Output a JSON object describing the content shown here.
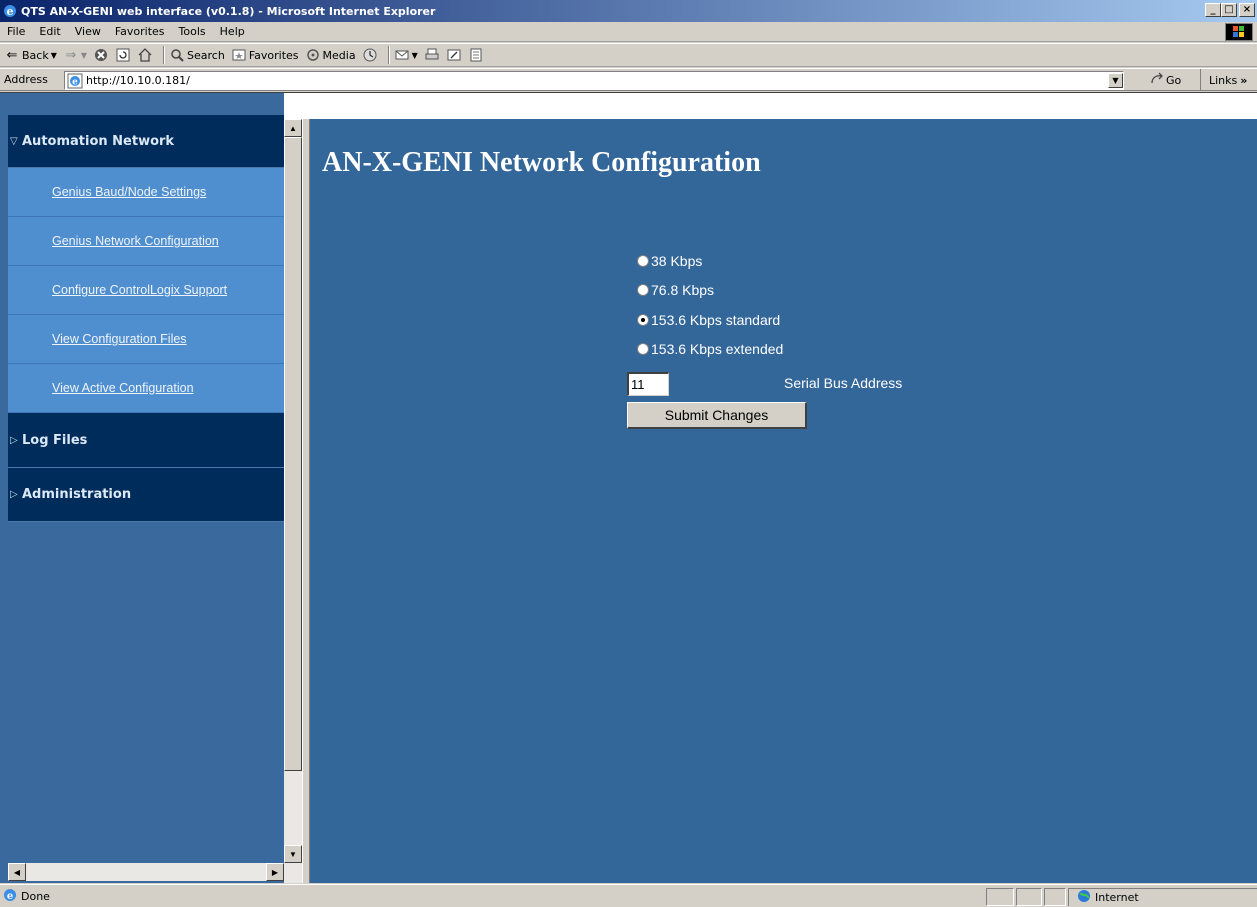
{
  "window": {
    "title": "QTS AN-X-GENI web interface (v0.1.8) - Microsoft Internet Explorer",
    "minimize_label": "_",
    "maximize_label": "□",
    "close_label": "×"
  },
  "menu": [
    "File",
    "Edit",
    "View",
    "Favorites",
    "Tools",
    "Help"
  ],
  "toolbar": {
    "back_label": "Back",
    "search_label": "Search",
    "favorites_label": "Favorites",
    "media_label": "Media"
  },
  "address": {
    "label": "Address",
    "url": "http://10.10.0.181/",
    "go_label": "Go",
    "links_label": "Links"
  },
  "sidebar": {
    "sections": [
      {
        "label": "Automation Network",
        "expanded": true,
        "items": [
          {
            "label": "Genius Baud/Node Settings"
          },
          {
            "label": "Genius Network Configuration"
          },
          {
            "label": "Configure ControlLogix Support"
          },
          {
            "label": "View Configuration Files"
          },
          {
            "label": "View Active Configuration"
          }
        ]
      },
      {
        "label": "Log Files",
        "expanded": false
      },
      {
        "label": "Administration",
        "expanded": false
      }
    ]
  },
  "content": {
    "title": "AN-X-GENI Network Configuration",
    "baud_options": [
      {
        "label": "38 Kbps",
        "checked": false
      },
      {
        "label": "76.8 Kbps",
        "checked": false
      },
      {
        "label": "153.6 Kbps standard",
        "checked": true
      },
      {
        "label": "153.6 Kbps extended",
        "checked": false
      }
    ],
    "serial_bus_address_value": "11",
    "serial_bus_address_label": "Serial Bus Address",
    "submit_label": "Submit Changes"
  },
  "status": {
    "text": "Done",
    "zone": "Internet"
  },
  "colors": {
    "sidebar_section_bg": "#002c5c",
    "sidebar_item_bg": "#4f8fd0",
    "content_bg": "#336699"
  }
}
